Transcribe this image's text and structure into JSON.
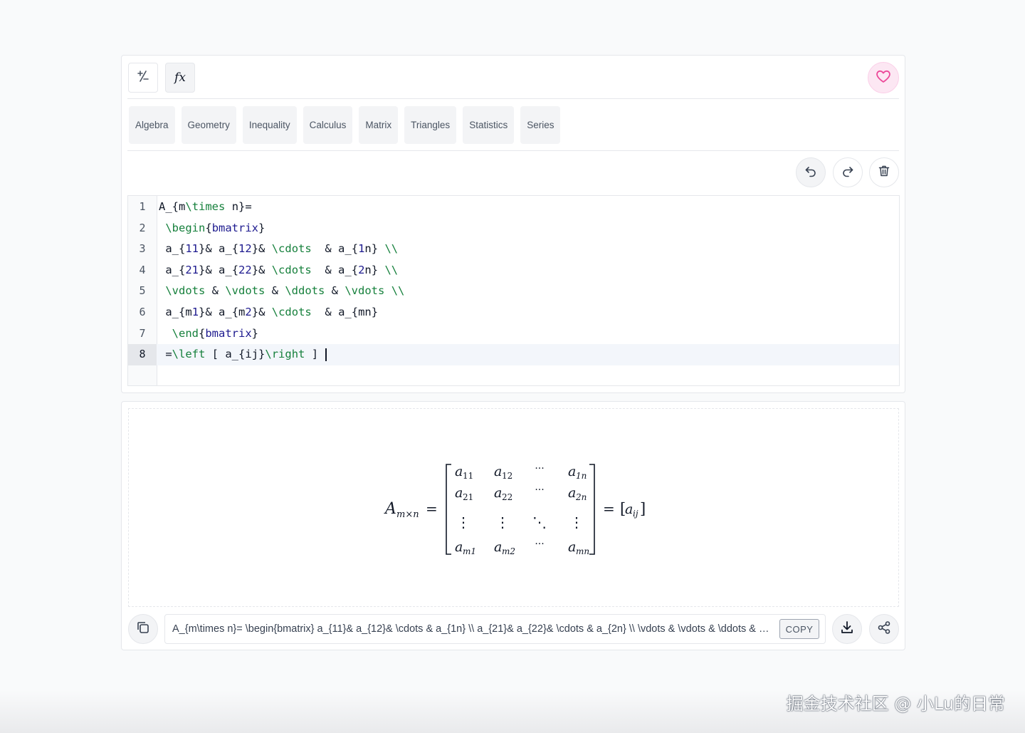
{
  "toolbar": {
    "plus_minus_icon": "plus-minus-icon",
    "fx_label": "fx",
    "favorite_icon": "heart-icon"
  },
  "tabs": [
    {
      "label": "Algebra"
    },
    {
      "label": "Geometry"
    },
    {
      "label": "Inequality"
    },
    {
      "label": "Calculus"
    },
    {
      "label": "Matrix"
    },
    {
      "label": "Triangles"
    },
    {
      "label": "Statistics"
    },
    {
      "label": "Series"
    }
  ],
  "editor_actions": {
    "undo_icon": "undo-icon",
    "redo_icon": "redo-icon",
    "delete_icon": "trash-icon"
  },
  "editor": {
    "active_line": 8,
    "lines": [
      {
        "number": "1",
        "text": "A_{m\\times n}="
      },
      {
        "number": "2",
        "text": " \\begin{bmatrix}"
      },
      {
        "number": "3",
        "text": " a_{11}& a_{12}& \\cdots  & a_{1n} \\\\"
      },
      {
        "number": "4",
        "text": " a_{21}& a_{22}& \\cdots  & a_{2n} \\\\"
      },
      {
        "number": "5",
        "text": " \\vdots & \\vdots & \\ddots & \\vdots \\\\"
      },
      {
        "number": "6",
        "text": " a_{m1}& a_{m2}& \\cdots  & a_{mn}"
      },
      {
        "number": "7",
        "text": "  \\end{bmatrix}"
      },
      {
        "number": "8",
        "text": " =\\left [ a_{ij}\\right ] "
      }
    ]
  },
  "preview": {
    "lhs_base": "A",
    "lhs_sub": "m×n",
    "equals": "=",
    "matrix": [
      [
        {
          "b": "a",
          "s": "11"
        },
        {
          "b": "a",
          "s": "12"
        },
        {
          "b": "···",
          "s": ""
        },
        {
          "b": "a",
          "s": "1n"
        }
      ],
      [
        {
          "b": "a",
          "s": "21"
        },
        {
          "b": "a",
          "s": "22"
        },
        {
          "b": "···",
          "s": ""
        },
        {
          "b": "a",
          "s": "2n"
        }
      ],
      [
        {
          "b": "⋮",
          "s": ""
        },
        {
          "b": "⋮",
          "s": ""
        },
        {
          "b": "⋱",
          "s": ""
        },
        {
          "b": "⋮",
          "s": ""
        }
      ],
      [
        {
          "b": "a",
          "s": "m1"
        },
        {
          "b": "a",
          "s": "m2"
        },
        {
          "b": "···",
          "s": ""
        },
        {
          "b": "a",
          "s": "mn"
        }
      ]
    ],
    "rhs_base": "a",
    "rhs_sub": "ij"
  },
  "output": {
    "latex": "A_{m\\times n}=  \\begin{bmatrix}  a_{11}& a_{12}& \\cdots  & a_{1n} \\\\  a_{21}& a_{22}& \\cdots  & a_{2n} \\\\  \\vdots & \\vdots & \\ddots & \\vdots \\\\  a_{m1}& a_{m2}& \\cdots  & a_{mn}  \\end{bmatrix}  =\\left [ a_{ij}\\right ]",
    "copy_label": "COPY",
    "copy_icon": "copy-icon",
    "download_icon": "download-icon",
    "share_icon": "share-icon"
  },
  "watermark": "掘金技术社区 @ 小Lu的日常",
  "colors": {
    "keyword": "#16803c",
    "argument": "#1e1b8f",
    "favorite_bg": "#fce7f3",
    "favorite_icon": "#ec4899"
  }
}
